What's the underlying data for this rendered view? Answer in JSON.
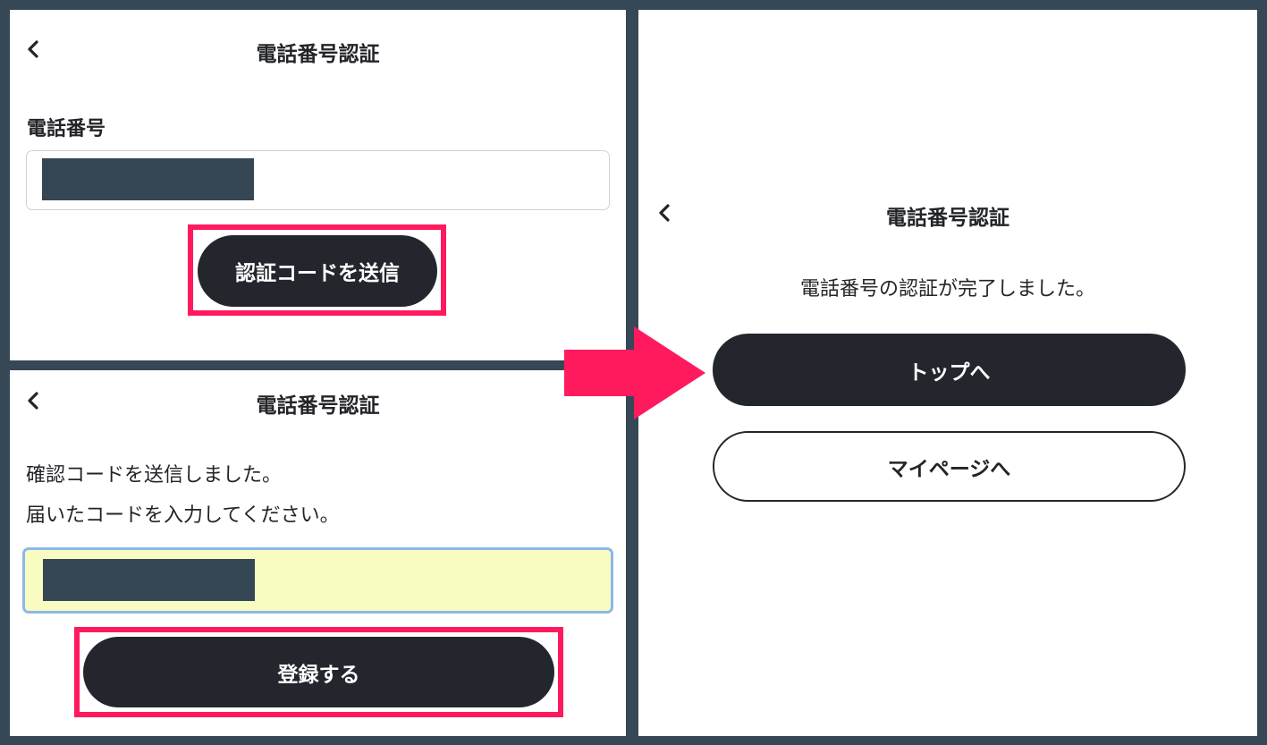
{
  "panels": {
    "send": {
      "title": "電話番号認証",
      "phone_label": "電話番号",
      "send_button_label": "認証コードを送信"
    },
    "verify": {
      "title": "電話番号認証",
      "message_line1": "確認コードを送信しました。",
      "message_line2": "届いたコードを入力してください。",
      "register_button_label": "登録する"
    },
    "done": {
      "title": "電話番号認証",
      "message": "電話番号の認証が完了しました。",
      "top_button_label": "トップへ",
      "mypage_button_label": "マイページへ"
    }
  },
  "icons": {
    "back": "chevron-left-icon",
    "flow_arrow": "arrow-right-icon"
  },
  "colors": {
    "background": "#364756",
    "panel": "#ffffff",
    "highlight": "#ff1a5e",
    "button_dark": "#23262d",
    "masked_value": "#354655",
    "active_input_fill": "#f8fcc0",
    "active_input_border": "#8ab8ec"
  }
}
